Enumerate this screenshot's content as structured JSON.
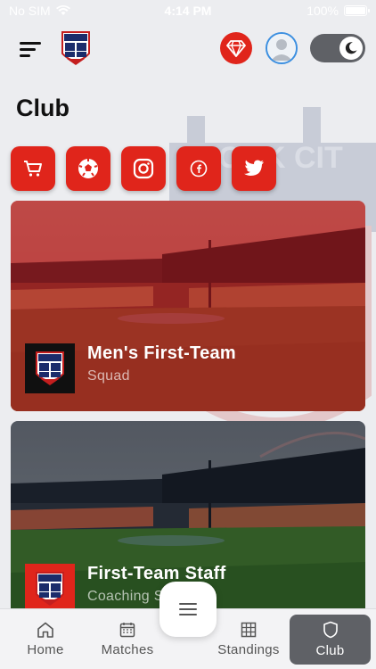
{
  "status_bar": {
    "carrier": "No SIM",
    "time": "4:14 PM",
    "battery": "100%"
  },
  "header": {
    "menu_icon": "hamburger-icon",
    "crest_icon": "club-crest-icon",
    "gem_icon": "diamond-icon",
    "avatar_icon": "user-avatar-icon",
    "theme_toggle_icon": "moon-icon",
    "accent": "#e0251b"
  },
  "page": {
    "title": "Club",
    "background_watermark": "ORK CIT"
  },
  "social": [
    {
      "icon": "cart-icon"
    },
    {
      "icon": "football-icon"
    },
    {
      "icon": "instagram-icon"
    },
    {
      "icon": "facebook-icon"
    },
    {
      "icon": "twitter-icon"
    }
  ],
  "cards": [
    {
      "title": "Men's First-Team",
      "subtitle": "Squad"
    },
    {
      "title": "First-Team Staff",
      "subtitle": "Coaching Staff"
    }
  ],
  "crest_text": "YORK CITY",
  "tabs": [
    {
      "label": "Home",
      "icon": "home-icon",
      "active": false
    },
    {
      "label": "Matches",
      "icon": "calendar-icon",
      "active": false
    },
    {
      "label": "Standings",
      "icon": "grid-icon",
      "active": false
    },
    {
      "label": "Club",
      "icon": "shield-icon",
      "active": true
    }
  ],
  "fab_icon": "menu-lines-icon"
}
